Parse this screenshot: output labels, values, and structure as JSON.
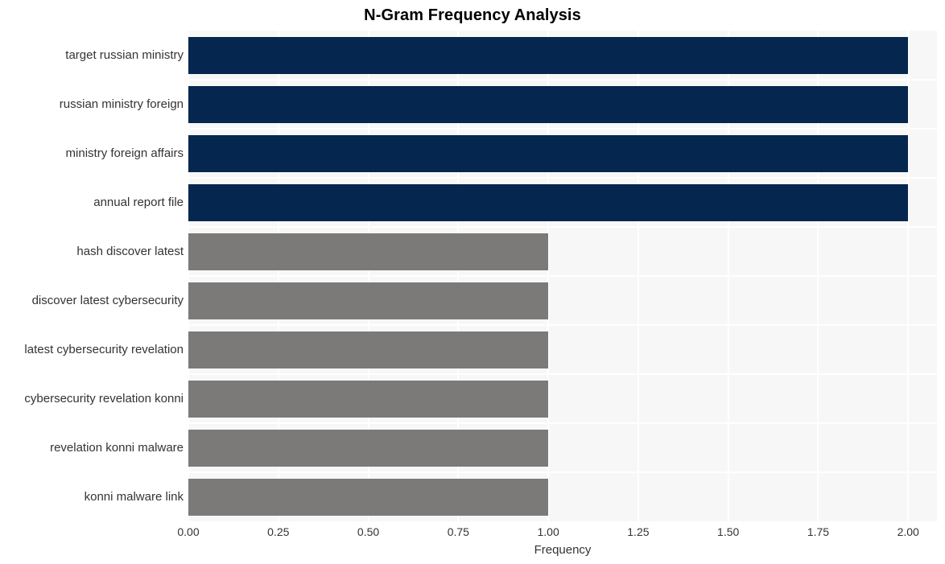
{
  "chart_data": {
    "type": "bar",
    "orientation": "horizontal",
    "title": "N-Gram Frequency Analysis",
    "xlabel": "Frequency",
    "ylabel": "",
    "categories": [
      "target russian ministry",
      "russian ministry foreign",
      "ministry foreign affairs",
      "annual report file",
      "hash discover latest",
      "discover latest cybersecurity",
      "latest cybersecurity revelation",
      "cybersecurity revelation konni",
      "revelation konni malware",
      "konni malware link"
    ],
    "values": [
      2,
      2,
      2,
      2,
      1,
      1,
      1,
      1,
      1,
      1
    ],
    "bar_colors": [
      "#042palette",
      "#04264f",
      "#04264f",
      "#04264f",
      "#7b7a78",
      "#7b7a78",
      "#7b7a78",
      "#7b7a78",
      "#7b7a78",
      "#7b7a78"
    ],
    "xlim": [
      0,
      2.08
    ],
    "xticks": [
      0,
      0.25,
      0.5,
      0.75,
      1.0,
      1.25,
      1.5,
      1.75,
      2.0
    ],
    "xtick_labels": [
      "0.00",
      "0.25",
      "0.50",
      "0.75",
      "1.00",
      "1.25",
      "1.50",
      "1.75",
      "2.00"
    ],
    "grid": true,
    "grid_color": "#ffffff",
    "legend": null,
    "plot_background": "#f7f7f7",
    "figure_background": "#ffffff",
    "color_high": "#04264f",
    "color_low": "#7b7a78",
    "text_color": "#333333"
  }
}
